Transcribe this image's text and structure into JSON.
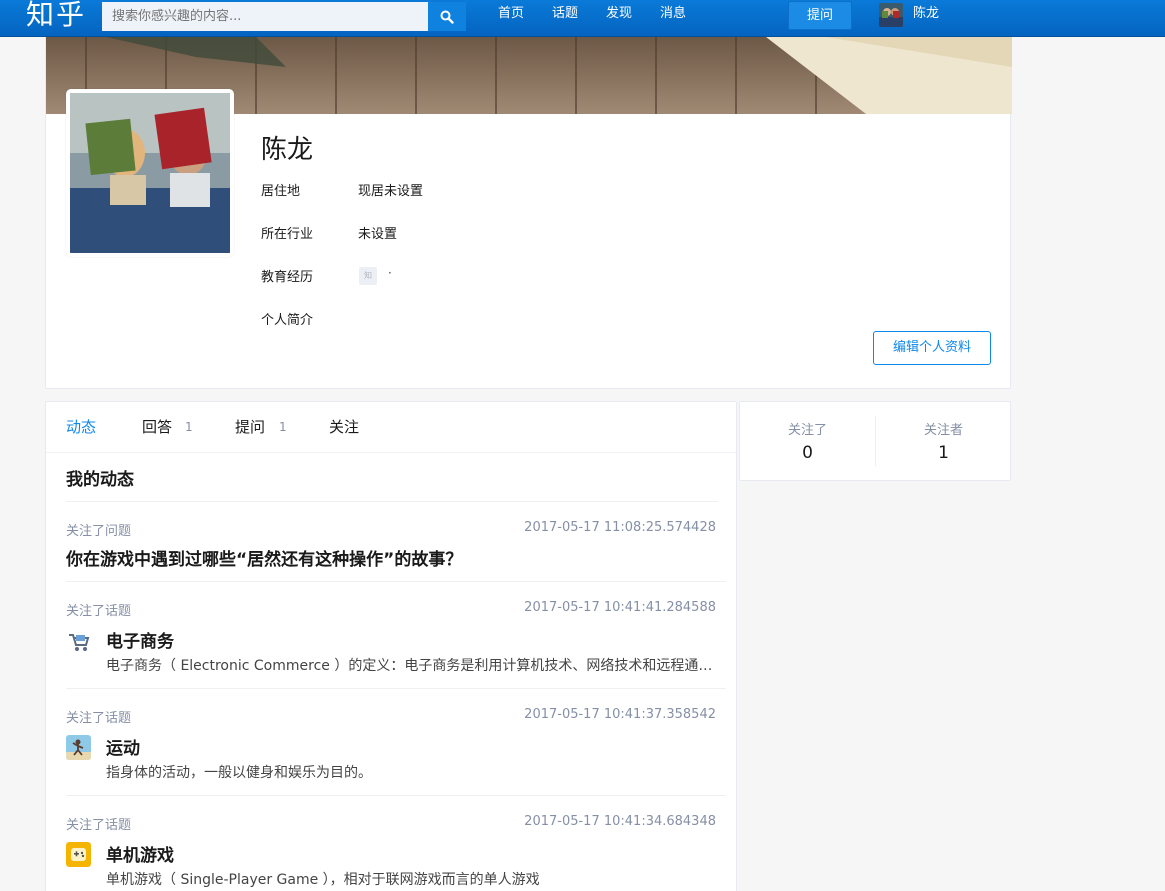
{
  "header": {
    "logo": "知乎",
    "search_placeholder": "搜索你感兴趣的内容...",
    "nav": [
      "首页",
      "话题",
      "发现",
      "消息"
    ],
    "ask_label": "提问",
    "user_name": "陈龙"
  },
  "profile": {
    "name": "陈龙",
    "fields": [
      {
        "label": "居住地",
        "value": "现居未设置"
      },
      {
        "label": "所在行业",
        "value": "未设置"
      },
      {
        "label": "教育经历",
        "value": "·"
      },
      {
        "label": "个人简介",
        "value": ""
      }
    ],
    "edu_icon_text": "知",
    "edit_label": "编辑个人资料"
  },
  "tabs": [
    {
      "label": "动态",
      "count": ""
    },
    {
      "label": "回答",
      "count": "1"
    },
    {
      "label": "提问",
      "count": "1"
    },
    {
      "label": "关注",
      "count": ""
    }
  ],
  "feed": {
    "title": "我的动态",
    "question_item": {
      "action": "关注了问题",
      "time": "2017-05-17 11:08:25.574428",
      "question": "你在游戏中遇到过哪些“居然还有这种操作”的故事？"
    },
    "topic_items": [
      {
        "action": "关注了话题",
        "time": "2017-05-17 10:41:41.284588",
        "name": "电子商务",
        "desc": "电子商务（ Electronic Commerce ）的定义：电子商务是利用计算机技术、网络技术和远程通信技术，实现电子化、数字化和网络化的整个商务过程。",
        "icon": "shopping-cart-icon"
      },
      {
        "action": "关注了话题",
        "time": "2017-05-17 10:41:37.358542",
        "name": "运动",
        "desc": "指身体的活动，一般以健身和娱乐为目的。",
        "icon": "sports-icon"
      },
      {
        "action": "关注了话题",
        "time": "2017-05-17 10:41:34.684348",
        "name": "单机游戏",
        "desc": "单机游戏（ Single-Player Game ），相对于联网游戏而言的单人游戏",
        "icon": "gamepad-icon"
      }
    ]
  },
  "side": {
    "following_label": "关注了",
    "following_count": "0",
    "followers_label": "关注者",
    "followers_count": "1"
  }
}
